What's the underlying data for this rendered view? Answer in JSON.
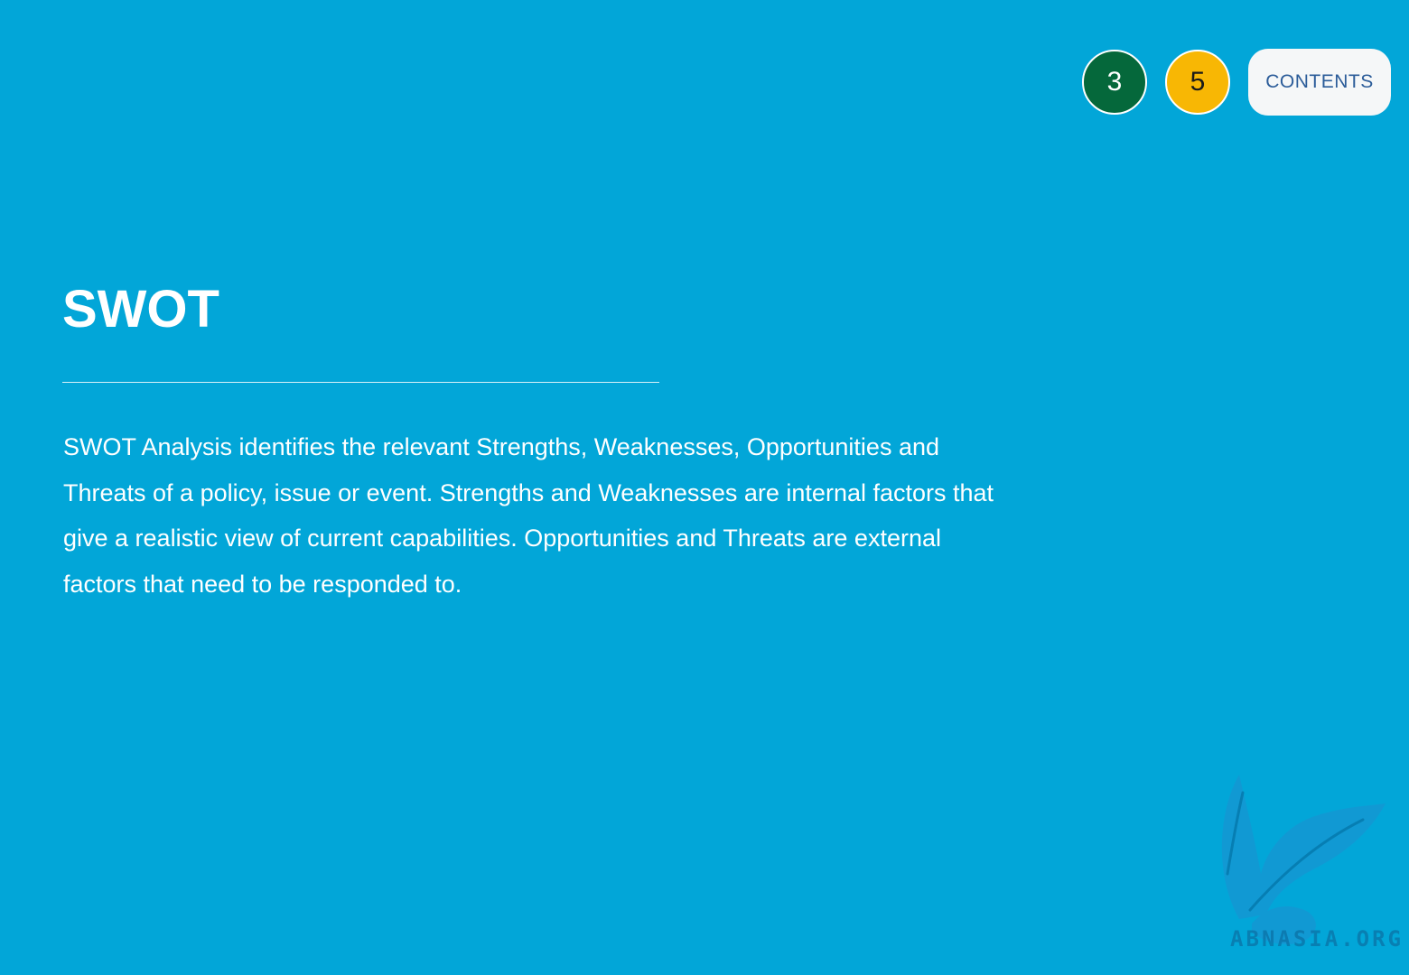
{
  "navigation": {
    "previous_page": "3",
    "next_page": "5",
    "contents_label": "CONTENTS"
  },
  "slide": {
    "title": "SWOT",
    "body": "SWOT Analysis identifies the relevant Strengths, Weaknesses, Opportunities and Threats of a policy, issue or event. Strengths and Weaknesses are internal factors that give a realistic view of current capabilities. Opportunities and Threats are external factors that need to be responded to."
  },
  "watermark": {
    "text": "ABNASIA.ORG",
    "icon": "feather-quill-icon"
  },
  "colors": {
    "background": "#02a6d8",
    "previous_button": "#05683b",
    "next_button": "#f8b704",
    "contents_button": "#f5f7f8",
    "contents_text": "#2b5c99",
    "text": "#ffffff"
  }
}
